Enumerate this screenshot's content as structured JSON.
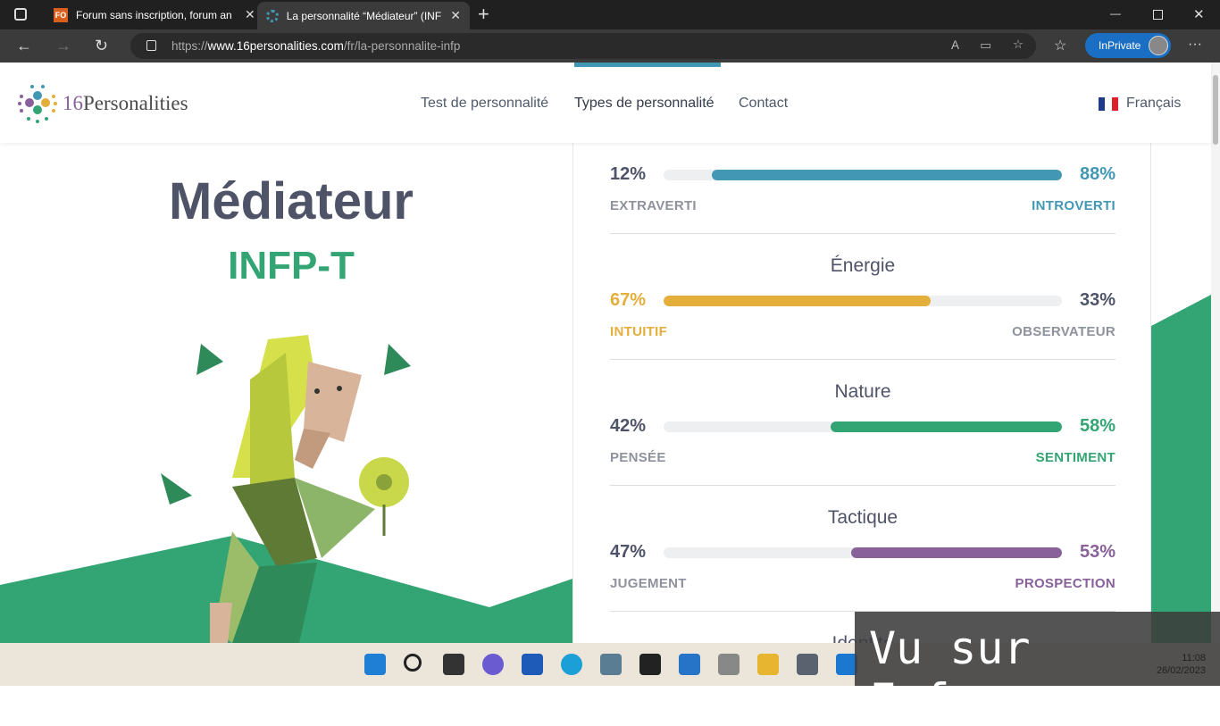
{
  "browser": {
    "tabs": [
      {
        "title": "Forum sans inscription, forum an",
        "icon": "fo-favicon"
      },
      {
        "title": "La personnalité “Médiateur” (INF",
        "icon": "16p-favicon",
        "active": true
      }
    ],
    "url_prefix": "https://",
    "url_domain": "www.16personalities.com",
    "url_path": "/fr/la-personnalite-infp",
    "inprivate_label": "InPrivate"
  },
  "site": {
    "logo_num": "16",
    "logo_word": "Personalities",
    "nav": [
      "Test de personnalité",
      "Types de personnalité",
      "Contact"
    ],
    "active_nav": "Types de personnalité",
    "language": "Français"
  },
  "hero": {
    "title": "Médiateur",
    "code": "INFP-T"
  },
  "traits": [
    {
      "name": "",
      "left_pct": "12%",
      "right_pct": "88%",
      "left_label": "EXTRAVERTI",
      "right_label": "INTROVERTI",
      "dominant": "right",
      "value": 88,
      "color": "#4298b4"
    },
    {
      "name": "Énergie",
      "left_pct": "67%",
      "right_pct": "33%",
      "left_label": "INTUITIF",
      "right_label": "OBSERVATEUR",
      "dominant": "left",
      "value": 67,
      "color": "#e4ae3a"
    },
    {
      "name": "Nature",
      "left_pct": "42%",
      "right_pct": "58%",
      "left_label": "PENSÉE",
      "right_label": "SENTIMENT",
      "dominant": "right",
      "value": 58,
      "color": "#33a474"
    },
    {
      "name": "Tactique",
      "left_pct": "47%",
      "right_pct": "53%",
      "left_label": "JUGEMENT",
      "right_label": "PROSPECTION",
      "dominant": "right",
      "value": 53,
      "color": "#88619a"
    },
    {
      "name": "Identité"
    }
  ],
  "watermark": "Vu sur Foforum",
  "clock": {
    "time": "11:08",
    "date": "26/02/2023"
  }
}
